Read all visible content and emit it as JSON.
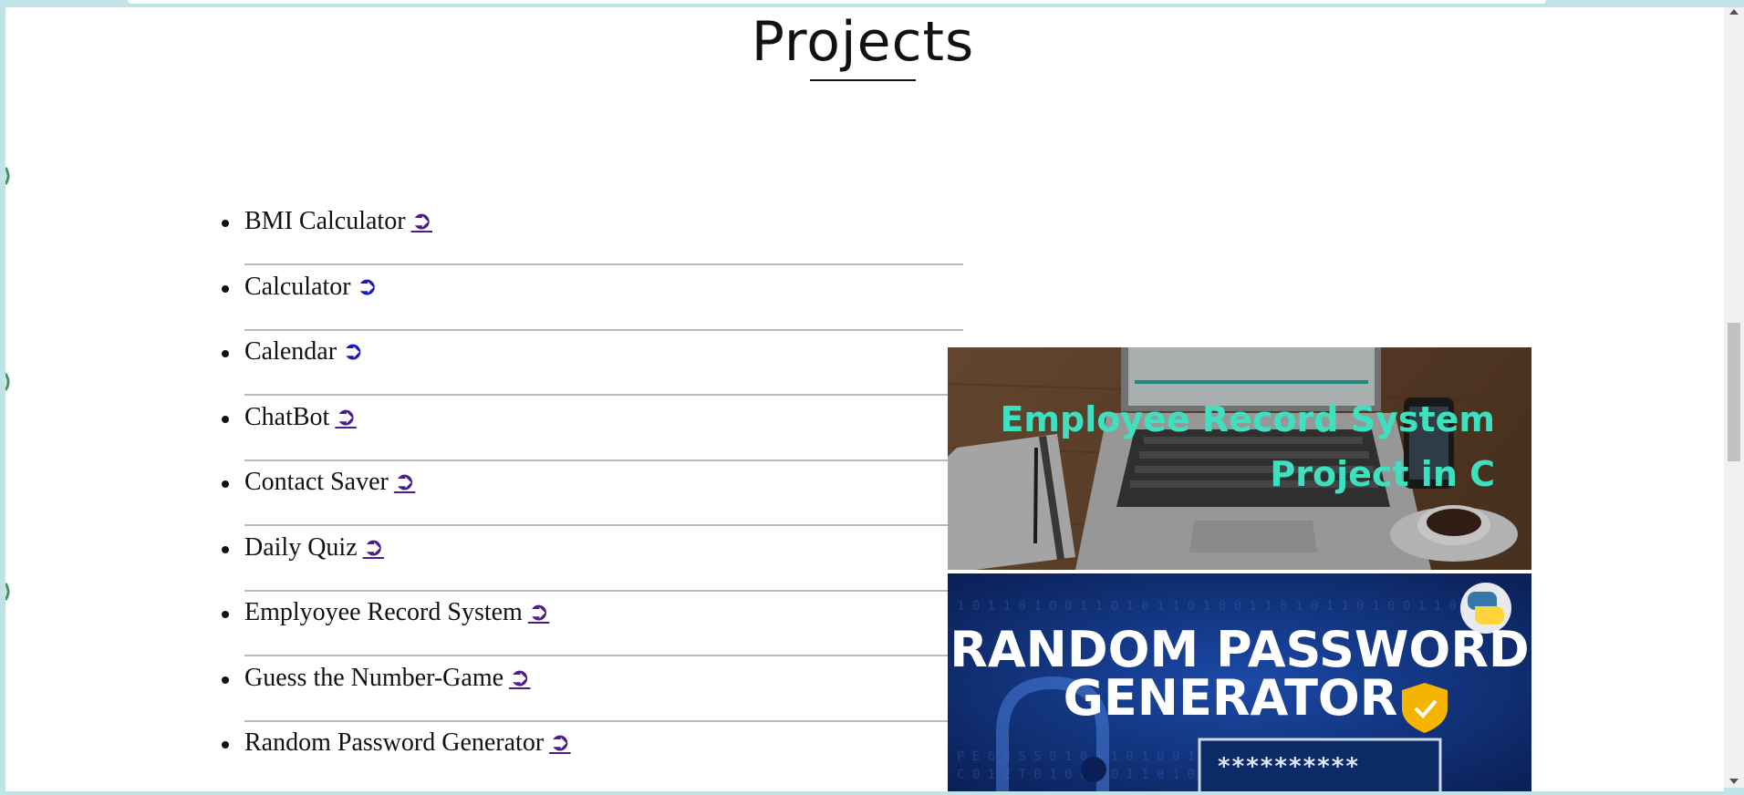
{
  "page": {
    "title": "Projects"
  },
  "projects": [
    {
      "name": "BMI Calculator",
      "link_glyph": "➲"
    },
    {
      "name": "Calculator",
      "link_glyph": "➲"
    },
    {
      "name": "Calendar",
      "link_glyph": "➲"
    },
    {
      "name": "ChatBot",
      "link_glyph": "➲"
    },
    {
      "name": "Contact Saver",
      "link_glyph": "➲"
    },
    {
      "name": "Daily Quiz",
      "link_glyph": "➲"
    },
    {
      "name": "Emplyoyee Record System",
      "link_glyph": "➲"
    },
    {
      "name": "Guess the Number-Game",
      "link_glyph": "➲"
    },
    {
      "name": "Random Password Generator",
      "link_glyph": "➲"
    }
  ],
  "images": {
    "employee": {
      "line1": "Employee Record System",
      "line2": "Project in C"
    },
    "password": {
      "line1": "RANDOM PASSWORD",
      "line2": "GENERATOR",
      "field": "**********"
    }
  },
  "colors": {
    "visited_link": "#4b1c8a",
    "unvisited_link": "#1a1ab5",
    "employee_text": "#3fe0c0",
    "password_bg": "#0d2a6b"
  }
}
